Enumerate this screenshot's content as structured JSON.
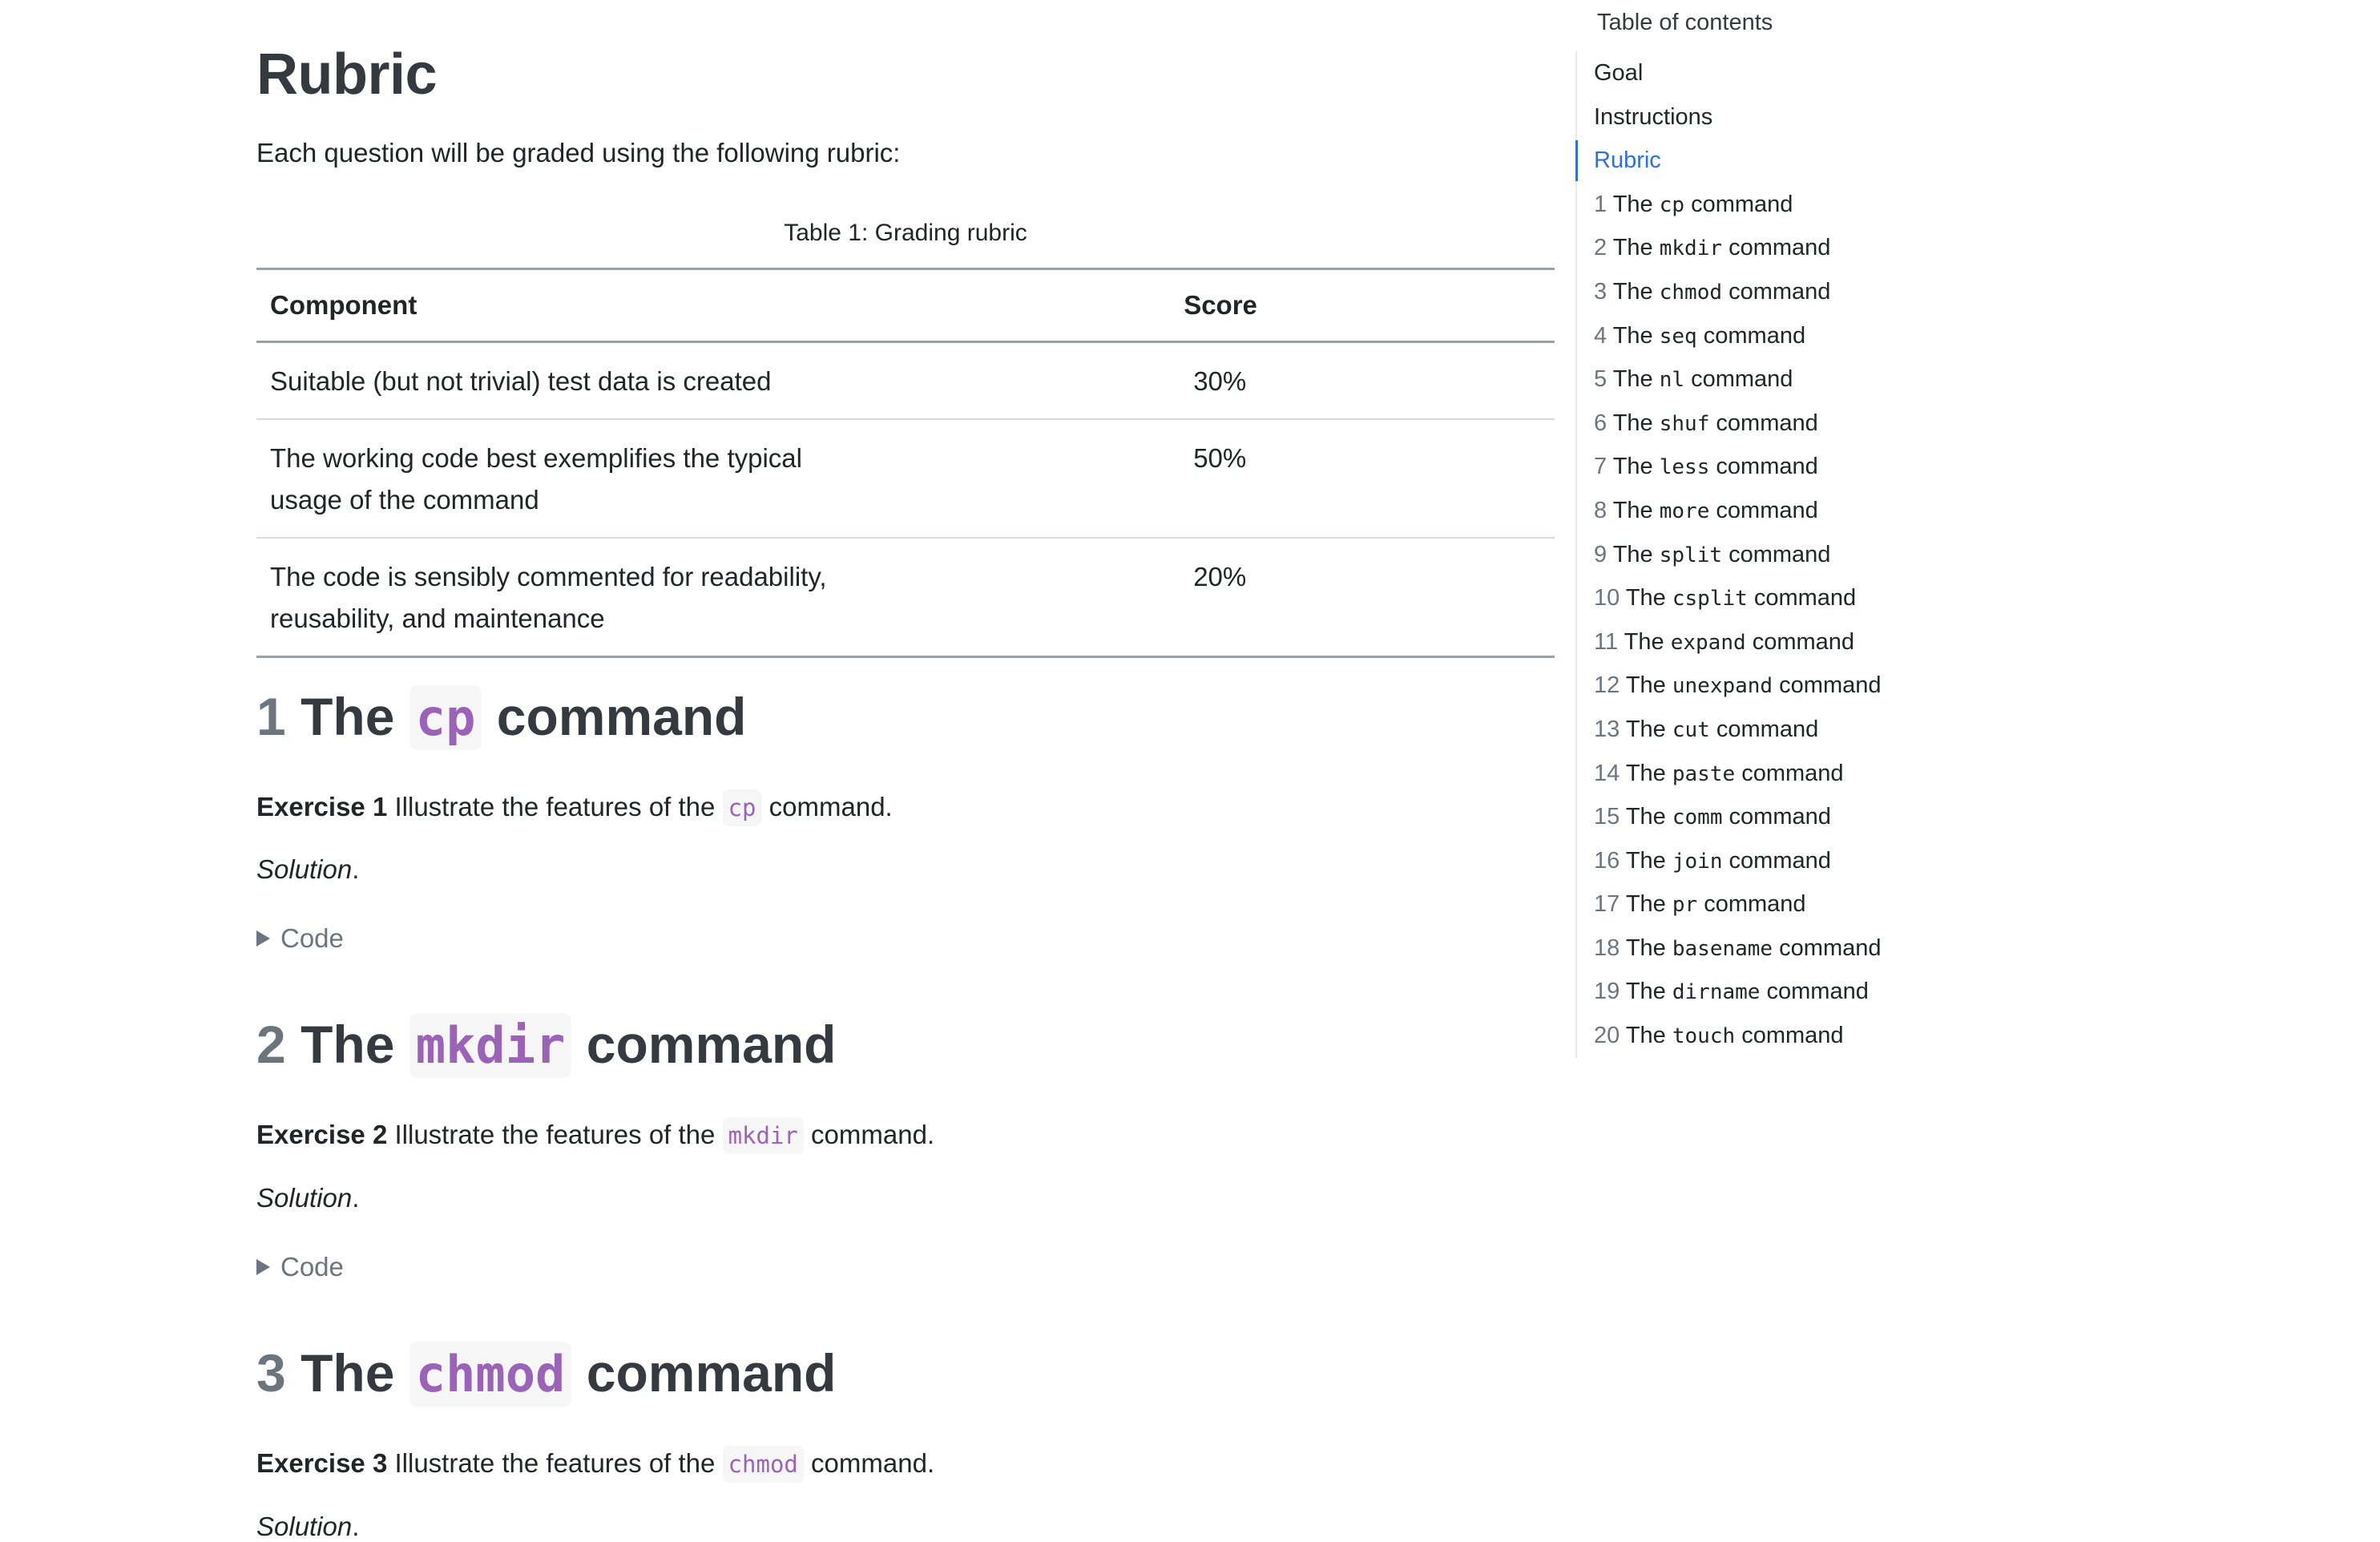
{
  "page": {
    "heading": "Rubric",
    "intro": "Each question will be graded using the following rubric:"
  },
  "rubric_table": {
    "caption": "Table 1: Grading rubric",
    "headers": [
      "Component",
      "Score"
    ],
    "rows": [
      {
        "component": "Suitable (but not trivial) test data is created",
        "score": "30%"
      },
      {
        "component": "The working code best exemplifies the typical usage of the command",
        "score": "50%"
      },
      {
        "component": "The code is sensibly commented for readability, reusability, and maintenance",
        "score": "20%"
      }
    ]
  },
  "sections": [
    {
      "number": "1",
      "title_pre": "The",
      "command": "cp",
      "title_post": "command",
      "exercise_label": "Exercise 1",
      "exercise_pre": "Illustrate the features of the",
      "exercise_post": "command.",
      "solution": "Solution",
      "solution_punct": ".",
      "code_toggle": "Code"
    },
    {
      "number": "2",
      "title_pre": "The",
      "command": "mkdir",
      "title_post": "command",
      "exercise_label": "Exercise 2",
      "exercise_pre": "Illustrate the features of the",
      "exercise_post": "command.",
      "solution": "Solution",
      "solution_punct": ".",
      "code_toggle": "Code"
    },
    {
      "number": "3",
      "title_pre": "The",
      "command": "chmod",
      "title_post": "command",
      "exercise_label": "Exercise 3",
      "exercise_pre": "Illustrate the features of the",
      "exercise_post": "command.",
      "solution": "Solution",
      "solution_punct": "."
    }
  ],
  "toc": {
    "title": "Table of contents",
    "active": "Rubric",
    "plain_items": [
      "Goal",
      "Instructions",
      "Rubric"
    ],
    "numbered_items": [
      {
        "num": "1",
        "pre": "The",
        "cmd": "cp",
        "post": "command"
      },
      {
        "num": "2",
        "pre": "The",
        "cmd": "mkdir",
        "post": "command"
      },
      {
        "num": "3",
        "pre": "The",
        "cmd": "chmod",
        "post": "command"
      },
      {
        "num": "4",
        "pre": "The",
        "cmd": "seq",
        "post": "command"
      },
      {
        "num": "5",
        "pre": "The",
        "cmd": "nl",
        "post": "command"
      },
      {
        "num": "6",
        "pre": "The",
        "cmd": "shuf",
        "post": "command"
      },
      {
        "num": "7",
        "pre": "The",
        "cmd": "less",
        "post": "command"
      },
      {
        "num": "8",
        "pre": "The",
        "cmd": "more",
        "post": "command"
      },
      {
        "num": "9",
        "pre": "The",
        "cmd": "split",
        "post": "command"
      },
      {
        "num": "10",
        "pre": "The",
        "cmd": "csplit",
        "post": "command"
      },
      {
        "num": "11",
        "pre": "The",
        "cmd": "expand",
        "post": "command"
      },
      {
        "num": "12",
        "pre": "The",
        "cmd": "unexpand",
        "post": "command"
      },
      {
        "num": "13",
        "pre": "The",
        "cmd": "cut",
        "post": "command"
      },
      {
        "num": "14",
        "pre": "The",
        "cmd": "paste",
        "post": "command"
      },
      {
        "num": "15",
        "pre": "The",
        "cmd": "comm",
        "post": "command"
      },
      {
        "num": "16",
        "pre": "The",
        "cmd": "join",
        "post": "command"
      },
      {
        "num": "17",
        "pre": "The",
        "cmd": "pr",
        "post": "command"
      },
      {
        "num": "18",
        "pre": "The",
        "cmd": "basename",
        "post": "command"
      },
      {
        "num": "19",
        "pre": "The",
        "cmd": "dirname",
        "post": "command"
      },
      {
        "num": "20",
        "pre": "The",
        "cmd": "touch",
        "post": "command"
      }
    ]
  },
  "colors": {
    "heading": "#343a40",
    "text": "#212529",
    "muted": "#6c757d",
    "code_fg": "#9b63b8",
    "code_bg": "#f6f6f6",
    "toc_active": "#2e6fe0",
    "table_rule": "#9aa1a5"
  }
}
